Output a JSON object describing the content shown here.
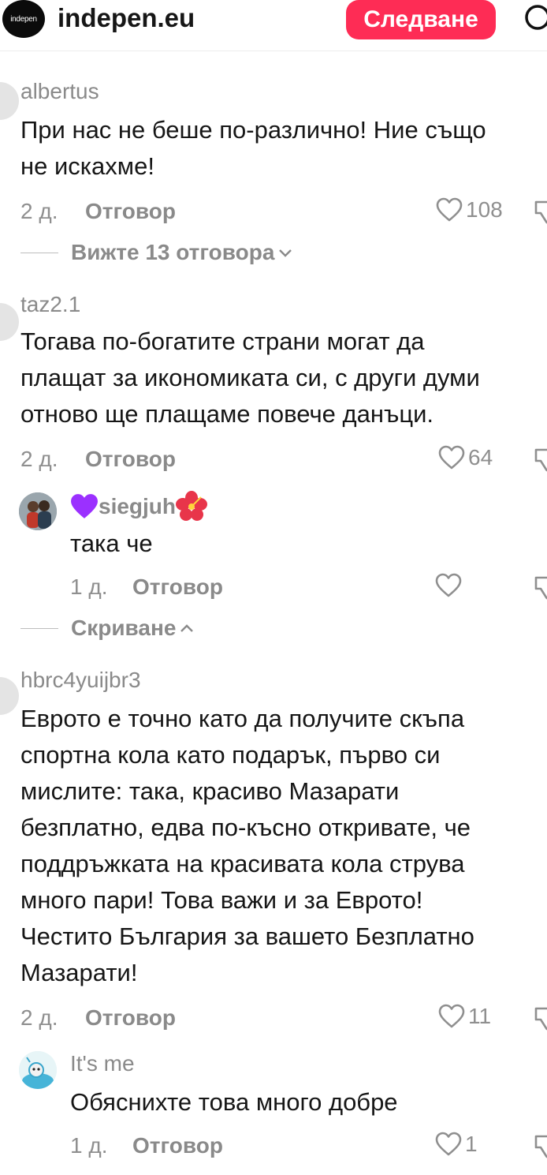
{
  "header": {
    "logo_text": "indepen",
    "account_name": "indepen.eu",
    "follow_label": "Следване",
    "search_icon": "search-icon"
  },
  "comments": [
    {
      "username": "albertus",
      "text": "При нас не беше по-различно! Ние също\nне искахме!",
      "age": "2 д.",
      "reply_label": "Отговор",
      "likes": "108",
      "view_replies": "Вижте 13 отговора"
    },
    {
      "username": "taz2.1",
      "text": "Тогава по-богатите страни могат да\nплащат за икономиката си, с други думи\nотново ще плащаме повече данъци.",
      "age": "2 д.",
      "reply_label": "Отговор",
      "likes": "64",
      "replies": [
        {
          "username": "siegjuh",
          "text": "така че",
          "age": "1 д.",
          "reply_label": "Отговор",
          "likes": ""
        }
      ],
      "hide_label": "Скриване"
    },
    {
      "username": "hbrc4yuijbr3",
      "text": "Еврото е точно като да получите скъпа\nспортна кола като подарък, първо си\nмислите: така, красиво Мазарати\nбезплатно, едва по-късно откривате, че\nподдръжката на красивата кола струва\nмного пари! Това важи и за Еврото!\nЧеститo България за вашето Безплатно\nМазарати!",
      "age": "2 д.",
      "reply_label": "Отговор",
      "likes": "11",
      "replies": [
        {
          "username": "It's me",
          "text": "Обяснихте това много добре",
          "age": "1 д.",
          "reply_label": "Отговор",
          "likes": "1"
        }
      ]
    }
  ],
  "colors": {
    "accent": "#fe2c55",
    "muted_text": "#8a8a8a",
    "body_text": "#161616"
  }
}
